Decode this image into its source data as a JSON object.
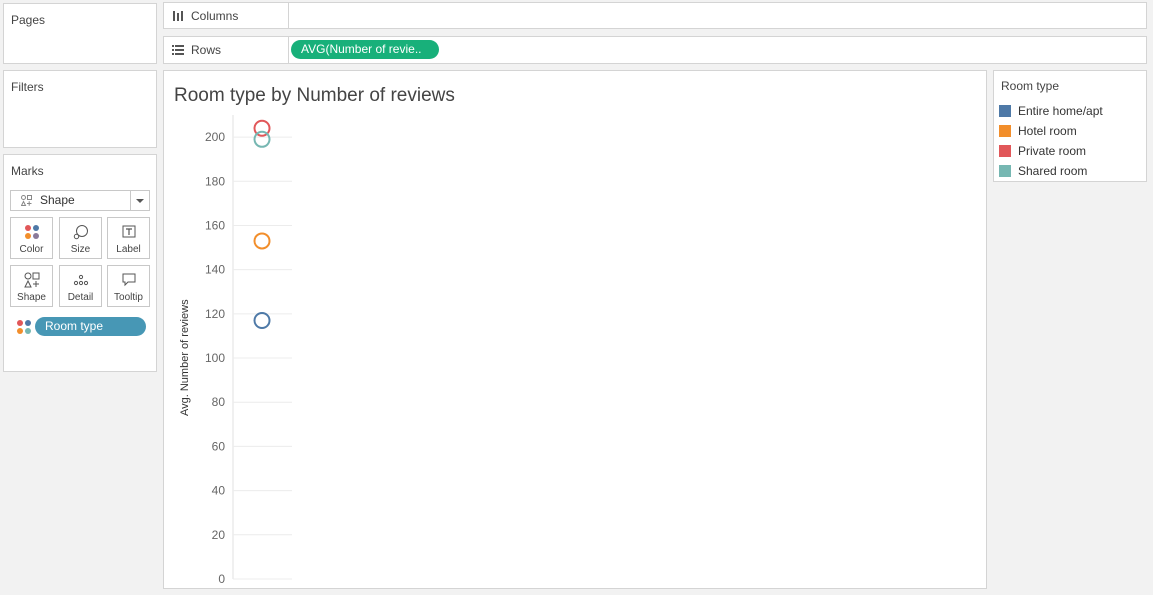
{
  "pages": {
    "title": "Pages"
  },
  "filters": {
    "title": "Filters"
  },
  "marks": {
    "title": "Marks",
    "mark_type": "Shape",
    "buttons": [
      {
        "label": "Color",
        "icon": "color-dots-icon"
      },
      {
        "label": "Size",
        "icon": "size-icon"
      },
      {
        "label": "Label",
        "icon": "label-icon"
      },
      {
        "label": "Shape",
        "icon": "shape-icon"
      },
      {
        "label": "Detail",
        "icon": "detail-icon"
      },
      {
        "label": "Tooltip",
        "icon": "tooltip-icon"
      }
    ],
    "color_field": "Room type"
  },
  "shelves": {
    "columns": {
      "label": "Columns"
    },
    "rows": {
      "label": "Rows",
      "pill": "AVG(Number of revie.."
    }
  },
  "legend": {
    "title": "Room type",
    "items": [
      {
        "label": "Entire home/apt",
        "color": "#4e79a7"
      },
      {
        "label": "Hotel room",
        "color": "#f28e2b"
      },
      {
        "label": "Private room",
        "color": "#e15759"
      },
      {
        "label": "Shared room",
        "color": "#76b7b2"
      }
    ]
  },
  "chart_data": {
    "type": "scatter",
    "title": "Room type by Number of reviews",
    "ylabel": "Avg. Number of reviews",
    "ylim": [
      0,
      210
    ],
    "yticks": [
      0,
      20,
      40,
      60,
      80,
      100,
      120,
      140,
      160,
      180,
      200
    ],
    "series": [
      {
        "name": "Entire home/apt",
        "value": 117,
        "color": "#4e79a7"
      },
      {
        "name": "Hotel room",
        "value": 153,
        "color": "#f28e2b"
      },
      {
        "name": "Private room",
        "value": 204,
        "color": "#e15759"
      },
      {
        "name": "Shared room",
        "value": 199,
        "color": "#76b7b2"
      }
    ]
  }
}
